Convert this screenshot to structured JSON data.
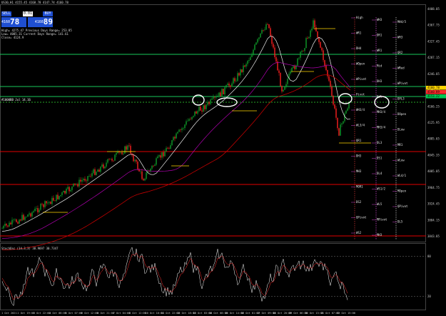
{
  "window": {
    "title": "US30,H1 4155.45 4168.78 4147.74 4160.78"
  },
  "ticket": {
    "sell_label": "SELL",
    "buy_label": "BUY",
    "lot": "0.01",
    "sell_small": "4160",
    "sell_big": "78",
    "buy_small": "4160",
    "buy_big": "89"
  },
  "info_lines": [
    "High= 4275.47      Previous Days Range= 253.85",
    "Low= 4085.31        Current Days Range= 141.61",
    "Close= 4124.9"
  ],
  "oscillator": {
    "title": "StochOsc (14,3,3) 38.9697 30.7347",
    "levels": [
      80,
      20
    ]
  },
  "date_labels": [
    "1 Oct 2021",
    "2 Oct 19:00",
    "3 Oct 22:00",
    "4 Oct 08:00",
    "5 Oct 07:00",
    "6 Oct 12:00",
    "6 Oct 21:00",
    "7 Oct 04:00",
    "8 Oct 12:00",
    "10 Oct 16:00",
    "11 Oct 22:00",
    "12 Oct 18:00",
    "13 Oct 03:00",
    "14 Oct 08:00",
    "15 Oct 14:00",
    "16 Oct 01:00",
    "17 Oct 09:00",
    "18 Oct 20:00",
    "19 Oct 06:00",
    "20 Oct 13:00",
    "21 Oct 07:00",
    "22 Oct 15:00"
  ],
  "price_labels": [
    "4408.05",
    "4367.75",
    "4327.45",
    "4287.15",
    "4246.85",
    "4206.55",
    "4166.25",
    "4125.95",
    "4085.65",
    "4045.35",
    "4005.05",
    "3964.75",
    "3924.45",
    "3884.15",
    "3843.85"
  ],
  "right_labels": [
    {
      "text": "High",
      "color": "#e8e8e8"
    },
    {
      "text": "WH3",
      "color": "#e8e8e8"
    },
    {
      "text": "MH4/5",
      "color": "#e8e8e8"
    },
    {
      "text": "WR1",
      "color": "#e8e8e8"
    },
    {
      "text": "DR1",
      "color": "#e8e8e8"
    },
    {
      "text": "WH3",
      "color": "#e8e8e8"
    },
    {
      "text": "DH4",
      "color": "#e8e8e8"
    },
    {
      "text": "WR1",
      "color": "#e8e8e8"
    },
    {
      "text": "QR2",
      "color": "#e8e8e8"
    },
    {
      "text": "WOpen",
      "color": "#e8e8e8"
    },
    {
      "text": "Mid",
      "color": "#e8e8e8"
    },
    {
      "text": "WRed",
      "color": "#e8e8e8"
    },
    {
      "text": "WPivot",
      "color": "#e8e8e8"
    },
    {
      "text": "DH3",
      "color": "#e8e8e8"
    },
    {
      "text": "WPivot",
      "color": "#e8e8e8"
    },
    {
      "text": "Pivot",
      "color": "#e8e8e8"
    },
    {
      "text": "Hdl",
      "color": "#e8e8e8"
    },
    {
      "text": "DPL3",
      "color": "#e8e8e8"
    },
    {
      "text": "WH3/4",
      "color": "#e8e8e8"
    },
    {
      "text": "MH3/4",
      "color": "#e8e8e8"
    },
    {
      "text": "DOpen",
      "color": "#e8e8e8"
    },
    {
      "text": "WL3/4",
      "color": "#e8e8e8"
    },
    {
      "text": "MH3/4",
      "color": "#e8e8e8"
    },
    {
      "text": "DLow",
      "color": "#e8e8e8"
    },
    {
      "text": "QR1",
      "color": "#e8e8e8"
    },
    {
      "text": "DL3",
      "color": "#e8e8e8"
    },
    {
      "text": "MR1",
      "color": "#e8e8e8"
    },
    {
      "text": "DH3",
      "color": "#e8e8e8"
    },
    {
      "text": "DS1",
      "color": "#e8e8e8"
    },
    {
      "text": "WLow",
      "color": "#e8e8e8"
    },
    {
      "text": "MH3",
      "color": "#e8e8e8"
    },
    {
      "text": "DL4",
      "color": "#e8e8e8"
    },
    {
      "text": "WL4/1",
      "color": "#e8e8e8"
    },
    {
      "text": "MOR1",
      "color": "#e8e8e8"
    },
    {
      "text": "WS1/2",
      "color": "#e8e8e8"
    },
    {
      "text": "MOpen",
      "color": "#e8e8e8"
    },
    {
      "text": "DS2",
      "color": "#e8e8e8"
    },
    {
      "text": "WL5",
      "color": "#e8e8e8"
    },
    {
      "text": "QPivot",
      "color": "#e8e8e8"
    },
    {
      "text": "QPivot",
      "color": "#e8e8e8"
    },
    {
      "text": "MPivot",
      "color": "#e8e8e8"
    },
    {
      "text": "DL5",
      "color": "#e8e8e8"
    },
    {
      "text": "WS2",
      "color": "#e8e8e8"
    },
    {
      "text": "MH3",
      "color": "#e8e8e8"
    }
  ],
  "price_tags": [
    {
      "text": "4160.78",
      "color": "#ffd400"
    },
    {
      "text": "4160.89",
      "color": "#ff2a2a"
    },
    {
      "text": "4153.22",
      "color": "#00c853"
    }
  ],
  "hline_label": "#1000BB Jul 14.16",
  "colors": {
    "bull": "#0f9d2a",
    "bear": "#ff2020",
    "ma_white": "#f0f0f0",
    "ma_red": "#c00000",
    "ma_purple": "#b000b0",
    "hl_green": "#19c85a",
    "hl_red": "#e00000",
    "yellow": "#ffd400"
  }
}
